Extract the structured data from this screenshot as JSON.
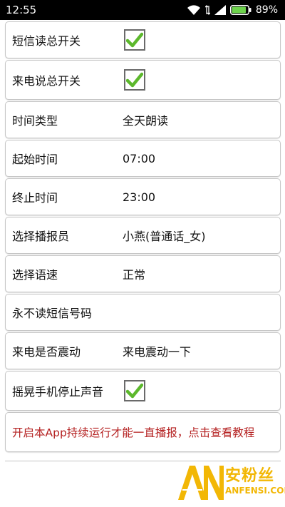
{
  "status_bar": {
    "time": "12:55",
    "battery_percent": "89%",
    "battery_level": 0.89
  },
  "settings": {
    "sms_read_switch": {
      "label": "短信读总开关",
      "checked": true
    },
    "call_speak_switch": {
      "label": "来电说总开关",
      "checked": true
    },
    "time_type": {
      "label": "时间类型",
      "value": "全天朗读"
    },
    "start_time": {
      "label": "起始时间",
      "value": "07:00"
    },
    "end_time": {
      "label": "终止时间",
      "value": "23:00"
    },
    "announcer": {
      "label": "选择播报员",
      "value": "小燕(普通话_女)"
    },
    "speech_rate": {
      "label": "选择语速",
      "value": "正常"
    },
    "never_read_numbers": {
      "label": "永不读短信号码"
    },
    "call_vibrate": {
      "label": "来电是否震动",
      "value": "来电震动一下"
    },
    "shake_stop": {
      "label": "摇晃手机停止声音",
      "checked": true
    },
    "notice": "开启本App持续运行才能一直播报，点击查看教程"
  },
  "watermark": {
    "logo_letters": "AN",
    "cn": "安粉丝",
    "en": "ANFENSI.COM"
  },
  "colors": {
    "check_green": "#5cb82c",
    "notice_red": "#b52222",
    "watermark_yellow": "#f2b705"
  }
}
